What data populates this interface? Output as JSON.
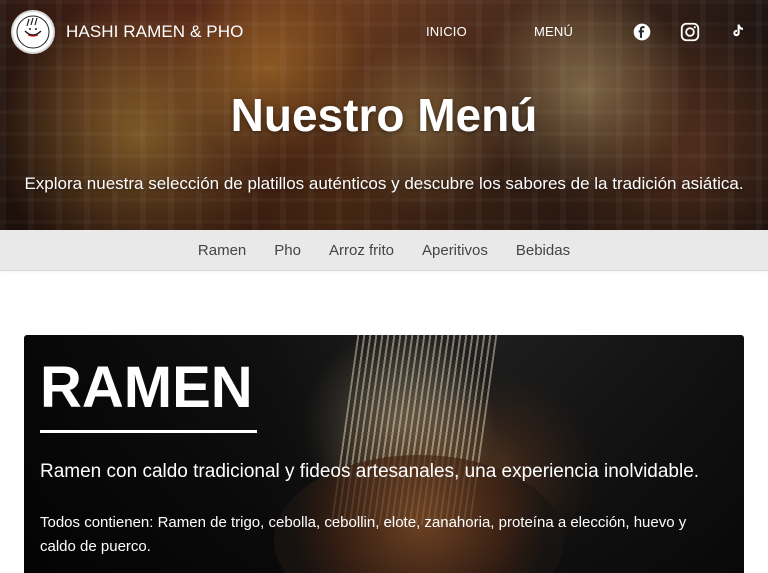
{
  "header": {
    "brand_name": "HASHI RAMEN & PHO",
    "nav": [
      "INICIO",
      "MENÚ"
    ],
    "social_icons": [
      "facebook-icon",
      "instagram-icon",
      "tiktok-icon"
    ]
  },
  "hero": {
    "title": "Nuestro Menú",
    "subtitle": "Explora nuestra selección de platillos auténticos y descubre los sabores de la tradición asiática."
  },
  "categories": [
    "Ramen",
    "Pho",
    "Arroz frito",
    "Aperitivos",
    "Bebidas"
  ],
  "section": {
    "title": "RAMEN",
    "description": "Ramen con caldo tradicional y fideos artesanales, una experiencia inolvidable.",
    "note": "Todos contienen: Ramen de trigo, cebolla, cebollin, elote, zanahoria, proteína a elección, huevo y caldo de puerco."
  },
  "colors": {
    "nav_text": "#ffffff",
    "category_bar_bg": "#e9e9e9",
    "category_text": "#444444",
    "card_text": "#ffffff"
  }
}
